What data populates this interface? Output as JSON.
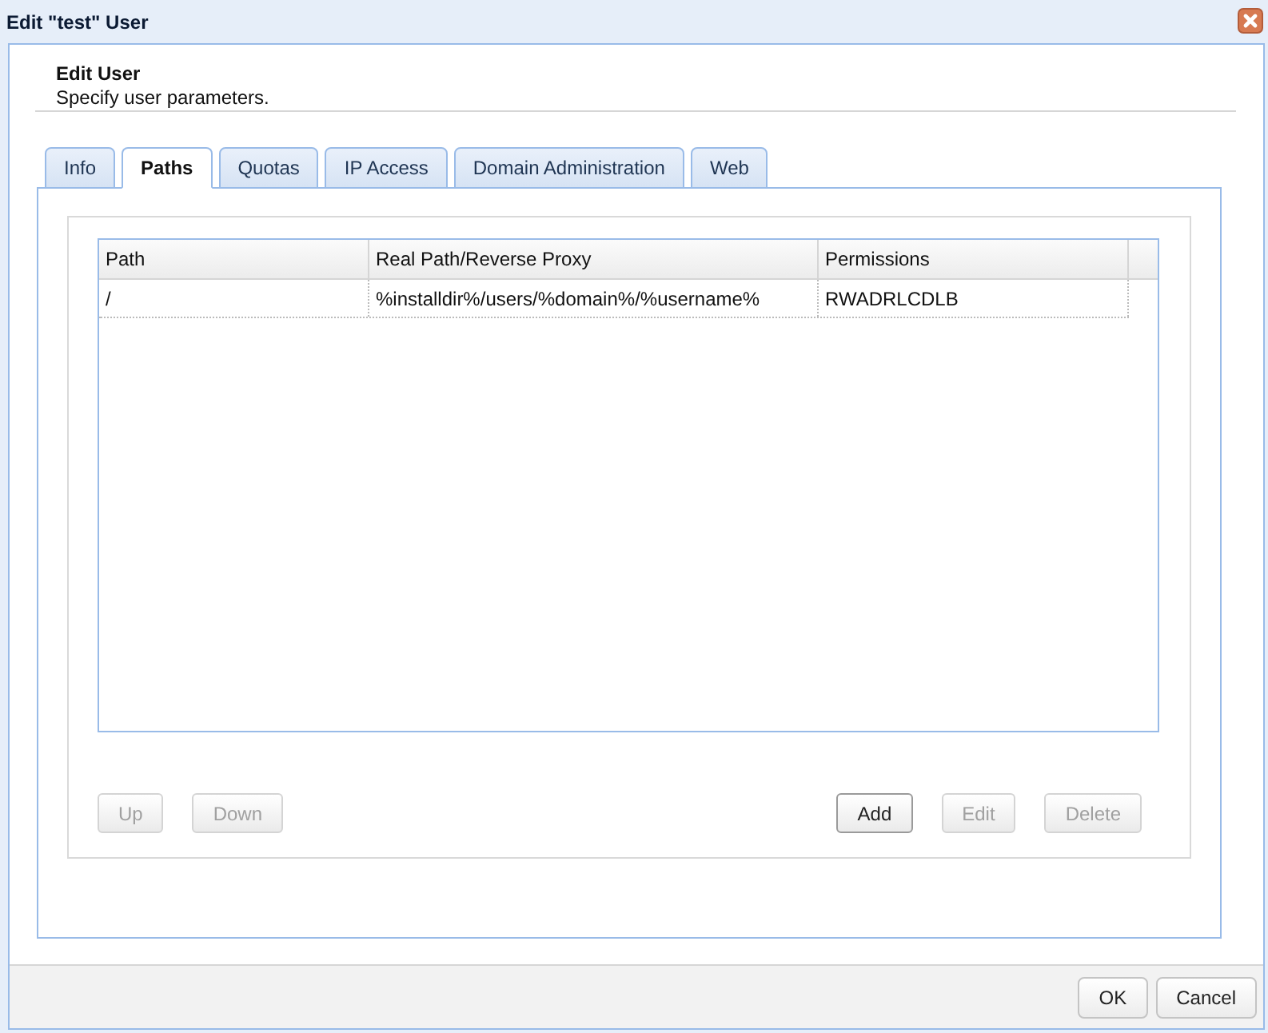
{
  "window": {
    "title": "Edit \"test\" User"
  },
  "header": {
    "title": "Edit User",
    "subtitle": "Specify user parameters."
  },
  "tabs": [
    {
      "label": "Info",
      "selected": false
    },
    {
      "label": "Paths",
      "selected": true
    },
    {
      "label": "Quotas",
      "selected": false
    },
    {
      "label": "IP Access",
      "selected": false
    },
    {
      "label": "Domain Administration",
      "selected": false
    },
    {
      "label": "Web",
      "selected": false
    }
  ],
  "table": {
    "columns": [
      "Path",
      "Real Path/Reverse Proxy",
      "Permissions"
    ],
    "rows": [
      {
        "cells": [
          "/",
          "%installdir%/users/%domain%/%username%",
          "RWADRLCDLB"
        ]
      }
    ]
  },
  "grid_buttons": {
    "left": [
      {
        "label": "Up",
        "disabled": true
      },
      {
        "label": "Down",
        "disabled": true
      }
    ],
    "right": [
      {
        "label": "Add",
        "disabled": false
      },
      {
        "label": "Edit",
        "disabled": true
      },
      {
        "label": "Delete",
        "disabled": true
      }
    ]
  },
  "footer_buttons": [
    {
      "label": "OK"
    },
    {
      "label": "Cancel"
    }
  ]
}
